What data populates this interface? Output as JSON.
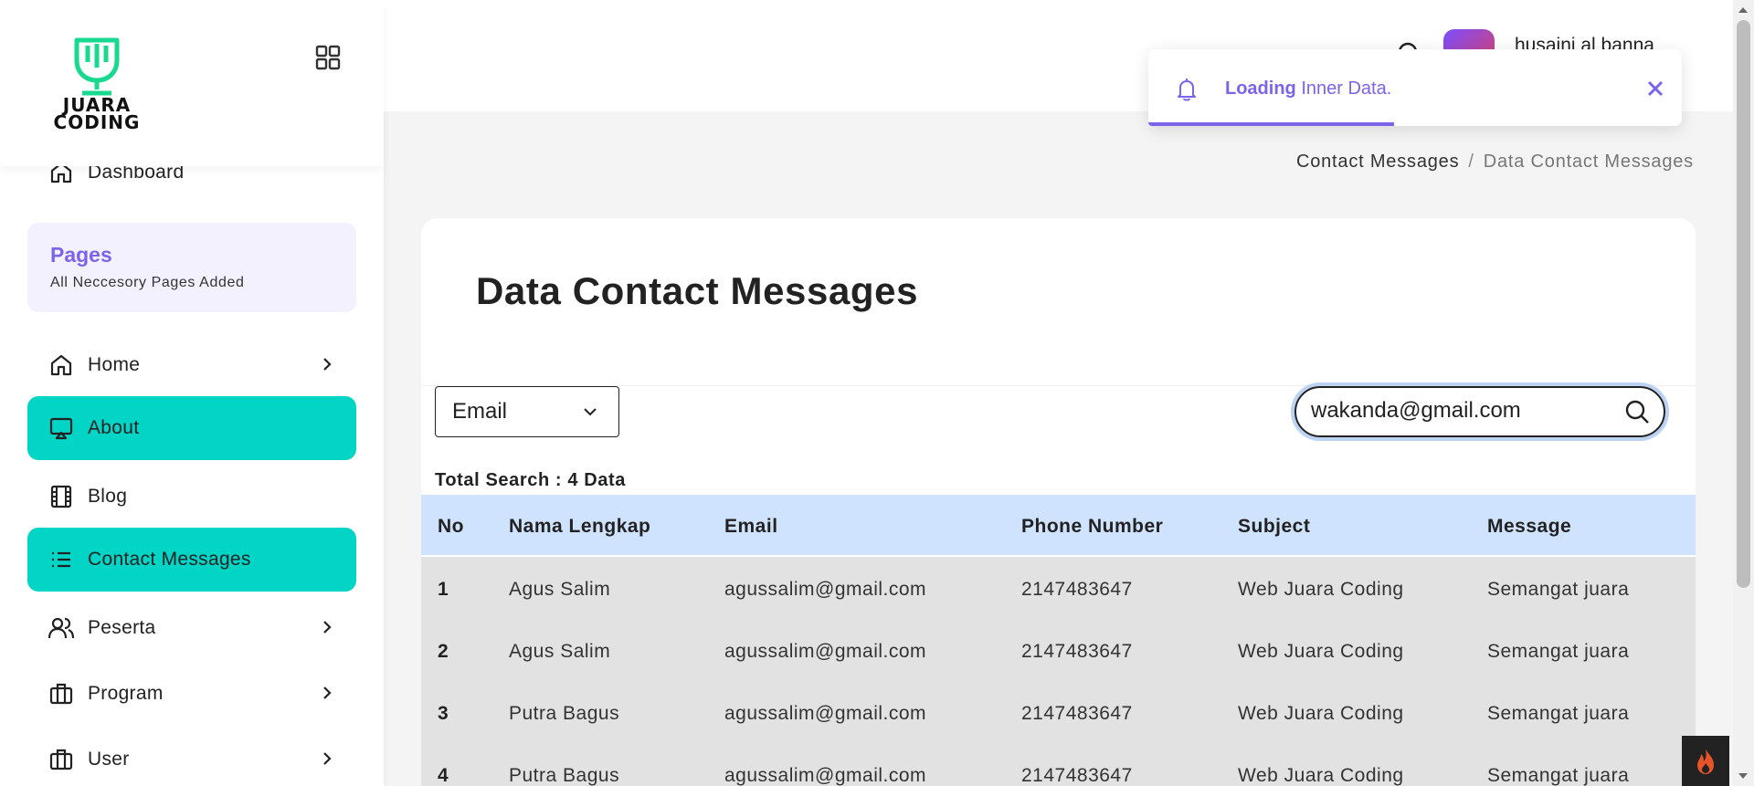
{
  "brand": {
    "logo_text_line1": "JUARA",
    "logo_text_line2": "CODING"
  },
  "sidebar": {
    "dashboard_label": "Dashboard",
    "pages_card": {
      "title": "Pages",
      "subtitle": "All Neccesory Pages Added"
    },
    "items": [
      {
        "label": "Home",
        "icon": "home-icon",
        "has_chevron": true,
        "active": false
      },
      {
        "label": "About",
        "icon": "presentation-icon",
        "has_chevron": false,
        "active": true
      },
      {
        "label": "Blog",
        "icon": "film-icon",
        "has_chevron": false,
        "active": false
      },
      {
        "label": "Contact Messages",
        "icon": "list-icon",
        "has_chevron": false,
        "active": true
      },
      {
        "label": "Peserta",
        "icon": "users-icon",
        "has_chevron": true,
        "active": false
      },
      {
        "label": "Program",
        "icon": "briefcase-icon",
        "has_chevron": true,
        "active": false
      },
      {
        "label": "User",
        "icon": "briefcase-icon",
        "has_chevron": true,
        "active": false
      }
    ]
  },
  "header": {
    "user_name": "husaini al banna"
  },
  "toast": {
    "bold": "Loading",
    "text": " Inner Data.",
    "progress": 0.46
  },
  "breadcrumb": {
    "parent": "Contact Messages",
    "separator": "/",
    "current": "Data Contact Messages"
  },
  "card": {
    "title": "Data Contact Messages",
    "filter_select_value": "Email",
    "search_value": "wakanda@gmail.com",
    "total_search": "Total Search : 4 Data"
  },
  "table": {
    "headers": [
      "No",
      "Nama Lengkap",
      "Email",
      "Phone Number",
      "Subject",
      "Message"
    ],
    "rows": [
      [
        "1",
        "Agus Salim",
        "agussalim@gmail.com",
        "2147483647",
        "Web Juara Coding",
        "Semangat juara"
      ],
      [
        "2",
        "Agus Salim",
        "agussalim@gmail.com",
        "2147483647",
        "Web Juara Coding",
        "Semangat juara"
      ],
      [
        "3",
        "Putra Bagus",
        "agussalim@gmail.com",
        "2147483647",
        "Web Juara Coding",
        "Semangat juara"
      ],
      [
        "4",
        "Putra Bagus",
        "agussalim@gmail.com",
        "2147483647",
        "Web Juara Coding",
        "Semangat juara"
      ]
    ]
  },
  "colors": {
    "accent_teal": "#02d5c6",
    "accent_purple": "#7c63e9",
    "table_header_bg": "#cfe2fe",
    "row_bg": "#e2e2e2"
  }
}
